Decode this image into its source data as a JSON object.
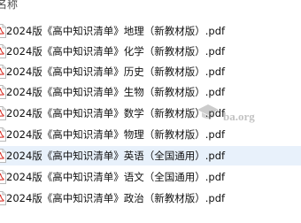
{
  "header": {
    "name_column": "名称"
  },
  "files": [
    {
      "name": "2024版《高中知识清单》地理（新教材版）.pdf",
      "selected": false
    },
    {
      "name": "2024版《高中知识清单》化学（新教材版）.pdf",
      "selected": false
    },
    {
      "name": "2024版《高中知识清单》历史（新教材版）.pdf",
      "selected": false
    },
    {
      "name": "2024版《高中知识清单》生物（新教材版）.pdf",
      "selected": false
    },
    {
      "name": "2024版《高中知识清单》数学（新教材版）.pdf",
      "selected": false
    },
    {
      "name": "2024版《高中知识清单》物理（新教材版）.pdf",
      "selected": false
    },
    {
      "name": "2024版《高中知识清单》英语（全国通用）.pdf",
      "selected": true
    },
    {
      "name": "2024版《高中知识清单》语文（全国通用）.pdf",
      "selected": false
    },
    {
      "name": "2024版《高中知识清单》政治（新教材版）.pdf",
      "selected": false
    }
  ],
  "icons": {
    "file_icon": "pdf-file-icon"
  },
  "colors": {
    "selected_row": "#e8f1fb",
    "pdf_red": "#d9342b"
  },
  "watermark": {
    "text": "ba.org"
  }
}
